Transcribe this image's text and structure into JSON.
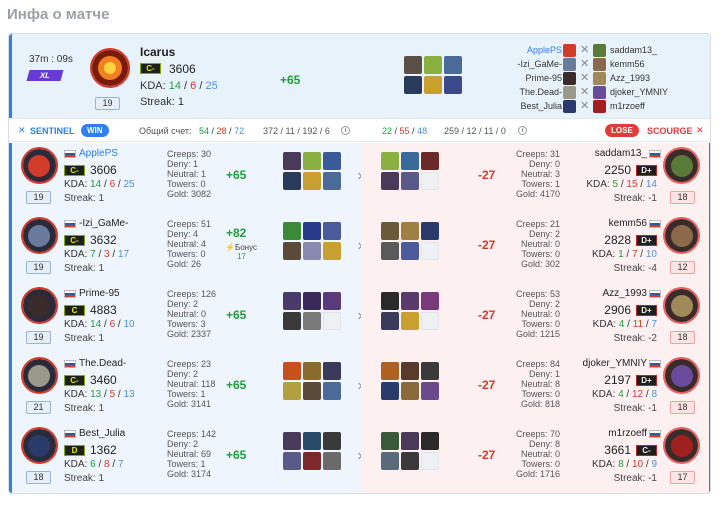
{
  "page_title": "Инфа о матче",
  "match": {
    "duration": "37m : 09s",
    "mode": "XL",
    "hero_player": "Icarus",
    "hero_rank": "C-",
    "hero_mmr": "3606",
    "kda_label": "KDA:",
    "kda_k": "14",
    "kda_d": "6",
    "kda_a": "25",
    "streak": "Streak: 1",
    "level": "19",
    "mmr_change": "+65"
  },
  "lineup": [
    {
      "left": "ApplePS",
      "right": "saddam13_"
    },
    {
      "left": "-Izi_GaMe-",
      "right": "kemm56"
    },
    {
      "left": "Prime-95",
      "right": "Azz_1993"
    },
    {
      "left": "The.Dead-",
      "right": "djoker_YMNIY"
    },
    {
      "left": "Best_Julia",
      "right": "m1rzoeff"
    }
  ],
  "bar": {
    "sentinel": "SENTINEL",
    "win": "WIN",
    "total_label": "Общий счет:",
    "s_k": "54",
    "s_d": "28",
    "s_a": "72",
    "s_cs": "372 / 11 / 192 / 6",
    "c_k": "22",
    "c_d": "55",
    "c_a": "48",
    "c_cs": "259 / 12 / 11 / 0",
    "lose": "LOSE",
    "scourge": "SCOURGE"
  },
  "left_players": [
    {
      "name": "ApplePS",
      "rank": "C-",
      "mmr": "3606",
      "k": "14",
      "d": "6",
      "a": "25",
      "streak": "Streak: 1",
      "level": "19",
      "creeps": "Creeps: 30",
      "deny": "Deny: 1",
      "neutral": "Neutral: 1",
      "towers": "Towers: 0",
      "gold": "Gold: 3082",
      "change": "+65",
      "bonus": ""
    },
    {
      "name": "-Izi_GaMe-",
      "rank": "C-",
      "mmr": "3632",
      "k": "7",
      "d": "3",
      "a": "17",
      "streak": "Streak: 1",
      "level": "19",
      "creeps": "Creeps: 51",
      "deny": "Deny: 4",
      "neutral": "Neutral: 4",
      "towers": "Towers: 0",
      "gold": "Gold: 26",
      "change": "+82",
      "bonus": "Бонус",
      "bonus_val": "17"
    },
    {
      "name": "Prime-95",
      "rank": "C",
      "mmr": "4883",
      "k": "14",
      "d": "6",
      "a": "10",
      "streak": "Streak: 1",
      "level": "19",
      "creeps": "Creeps: 126",
      "deny": "Deny: 2",
      "neutral": "Neutral: 0",
      "towers": "Towers: 3",
      "gold": "Gold: 2337",
      "change": "+65",
      "bonus": ""
    },
    {
      "name": "The.Dead-",
      "rank": "C-",
      "mmr": "3460",
      "k": "13",
      "d": "5",
      "a": "13",
      "streak": "Streak: 1",
      "level": "21",
      "creeps": "Creeps: 23",
      "deny": "Deny: 2",
      "neutral": "Neutral: 118",
      "towers": "Towers: 1",
      "gold": "Gold: 3141",
      "change": "+65",
      "bonus": ""
    },
    {
      "name": "Best_Julia",
      "rank": "D",
      "mmr": "1362",
      "k": "6",
      "d": "8",
      "a": "7",
      "streak": "Streak: 1",
      "level": "18",
      "creeps": "Creeps: 142",
      "deny": "Deny: 2",
      "neutral": "Neutral: 69",
      "towers": "Towers: 1",
      "gold": "Gold: 3174",
      "change": "+65",
      "bonus": ""
    }
  ],
  "right_players": [
    {
      "name": "saddam13_",
      "rank": "D+",
      "mmr": "2250",
      "k": "5",
      "d": "15",
      "a": "14",
      "streak": "Streak: -1",
      "level": "18",
      "creeps": "Creeps: 31",
      "deny": "Deny: 0",
      "neutral": "Neutral: 3",
      "towers": "Towers: 1",
      "gold": "Gold: 4170",
      "change": "-27"
    },
    {
      "name": "kemm56",
      "rank": "D+",
      "mmr": "2828",
      "k": "1",
      "d": "7",
      "a": "10",
      "streak": "Streak: -4",
      "level": "12",
      "creeps": "Creeps: 21",
      "deny": "Deny: 2",
      "neutral": "Neutral: 0",
      "towers": "Towers: 0",
      "gold": "Gold: 302",
      "change": "-27"
    },
    {
      "name": "Azz_1993",
      "rank": "D+",
      "mmr": "2906",
      "k": "4",
      "d": "11",
      "a": "7",
      "streak": "Streak: -2",
      "level": "18",
      "creeps": "Creeps: 53",
      "deny": "Deny: 2",
      "neutral": "Neutral: 0",
      "towers": "Towers: 0",
      "gold": "Gold: 1215",
      "change": "-27"
    },
    {
      "name": "djoker_YMNIY",
      "rank": "D+",
      "mmr": "2197",
      "k": "4",
      "d": "12",
      "a": "8",
      "streak": "Streak: -1",
      "level": "18",
      "creeps": "Creeps: 84",
      "deny": "Deny: 1",
      "neutral": "Neutral: 8",
      "towers": "Towers: 0",
      "gold": "Gold: 818",
      "change": "-27"
    },
    {
      "name": "m1rzoeff",
      "rank": "C-",
      "mmr": "3661",
      "k": "8",
      "d": "10",
      "a": "9",
      "streak": "Streak: -1",
      "level": "17",
      "creeps": "Creeps: 70",
      "deny": "Deny: 8",
      "neutral": "Neutral: 0",
      "towers": "Towers: 0",
      "gold": "Gold: 1716",
      "change": "-27"
    }
  ],
  "colors": {
    "sentinel": "#2f80ed",
    "scourge": "#e23b3b",
    "win_green": "#1f9d3a",
    "loss_red": "#d23a2a"
  }
}
